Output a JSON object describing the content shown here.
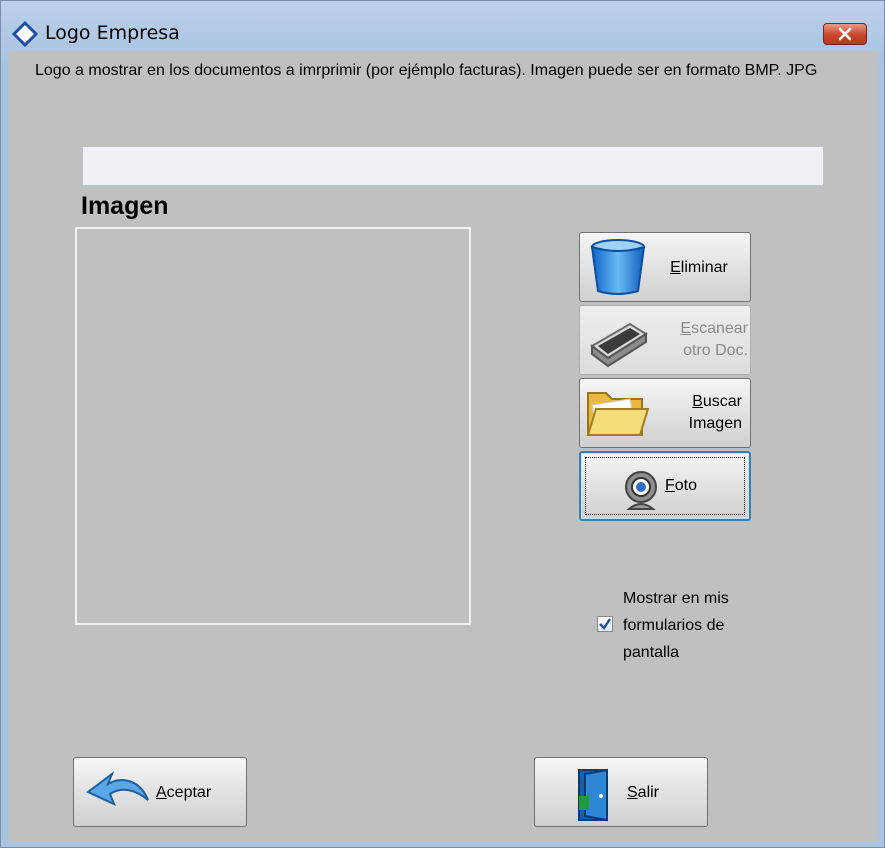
{
  "window": {
    "title": "Logo Empresa"
  },
  "description": "Logo a mostrar en los documentos a imrprimir (por ejémplo facturas). Imagen puede ser en formato BMP. JPG",
  "path_input": {
    "value": ""
  },
  "image_section": {
    "label": "Imagen"
  },
  "buttons": {
    "eliminar": {
      "label_first": "E",
      "label_rest": "liminar"
    },
    "escanear": {
      "line1_first": "E",
      "line1_rest": "scanear",
      "line2": "otro Doc."
    },
    "buscar": {
      "line1_first": "B",
      "line1_rest": "uscar",
      "line2": "Imagen"
    },
    "foto": {
      "label_first": "F",
      "label_rest": "oto"
    },
    "aceptar": {
      "label_first": "A",
      "label_rest": "ceptar"
    },
    "salir": {
      "label_first": "S",
      "label_rest": "alir"
    }
  },
  "checkbox": {
    "label_line1": "Mostrar en mis",
    "label_line2": "formularios de",
    "label_line3": "pantalla",
    "checked": true
  },
  "icons": {
    "title": "window-app-icon",
    "close": "close-icon",
    "eliminar": "trash-bin-icon",
    "escanear": "scanner-icon",
    "buscar": "folder-icon",
    "foto": "webcam-icon",
    "aceptar": "curved-arrow-icon",
    "salir": "exit-door-icon"
  }
}
